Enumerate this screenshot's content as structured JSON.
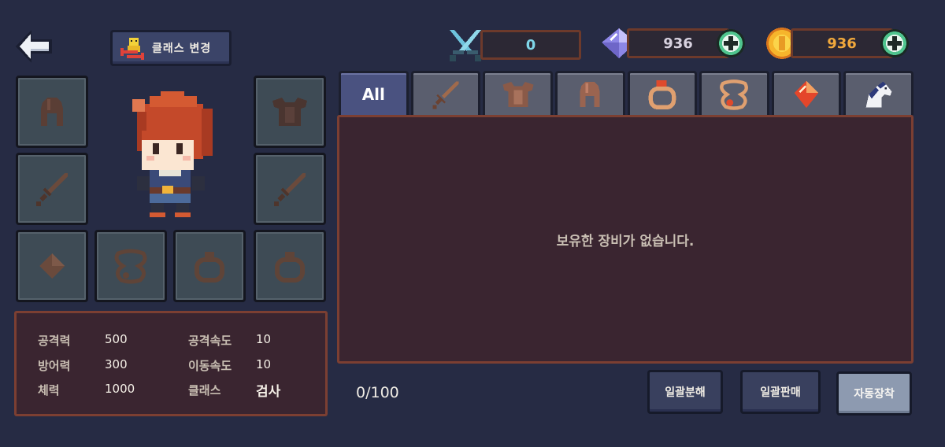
{
  "header": {
    "class_change_label": "클래스 변경"
  },
  "currencies": {
    "pvp": {
      "icon": "crossed-swords-icon",
      "value": "0",
      "color": "#7fd6e8"
    },
    "gem": {
      "icon": "diamond-icon",
      "value": "936",
      "color": "#d8d2e0"
    },
    "gold": {
      "icon": "gold-coin-icon",
      "value": "936",
      "color": "#f0a83c"
    }
  },
  "equipment_slots": [
    {
      "slot": "helmet",
      "icon": "helmet-icon"
    },
    {
      "slot": "armor",
      "icon": "armor-icon"
    },
    {
      "slot": "weapon-left",
      "icon": "sword-icon"
    },
    {
      "slot": "weapon-right",
      "icon": "sword-icon"
    },
    {
      "slot": "gem",
      "icon": "gem-icon"
    },
    {
      "slot": "necklace",
      "icon": "necklace-icon"
    },
    {
      "slot": "ring-1",
      "icon": "ring-icon"
    },
    {
      "slot": "ring-2",
      "icon": "ring-icon"
    }
  ],
  "stats": {
    "attack": {
      "label": "공격력",
      "value": "500"
    },
    "attack_speed": {
      "label": "공격속도",
      "value": "10"
    },
    "defense": {
      "label": "방어력",
      "value": "300"
    },
    "move_speed": {
      "label": "이동속도",
      "value": "10"
    },
    "hp": {
      "label": "체력",
      "value": "1000"
    },
    "class": {
      "label": "클래스",
      "value": "검사"
    }
  },
  "inventory": {
    "tabs": [
      {
        "label": "All",
        "icon": "",
        "active": true
      },
      {
        "label": "",
        "icon": "sword-icon"
      },
      {
        "label": "",
        "icon": "armor-icon"
      },
      {
        "label": "",
        "icon": "helmet-icon"
      },
      {
        "label": "",
        "icon": "ring-icon"
      },
      {
        "label": "",
        "icon": "necklace-icon"
      },
      {
        "label": "",
        "icon": "gem-icon"
      },
      {
        "label": "",
        "icon": "horse-icon"
      }
    ],
    "empty_message": "보유한 장비가 없습니다.",
    "capacity": "0/100"
  },
  "actions": {
    "bulk_dismantle": "일괄분해",
    "bulk_sell": "일괄판매",
    "auto_equip": "자동장착"
  }
}
